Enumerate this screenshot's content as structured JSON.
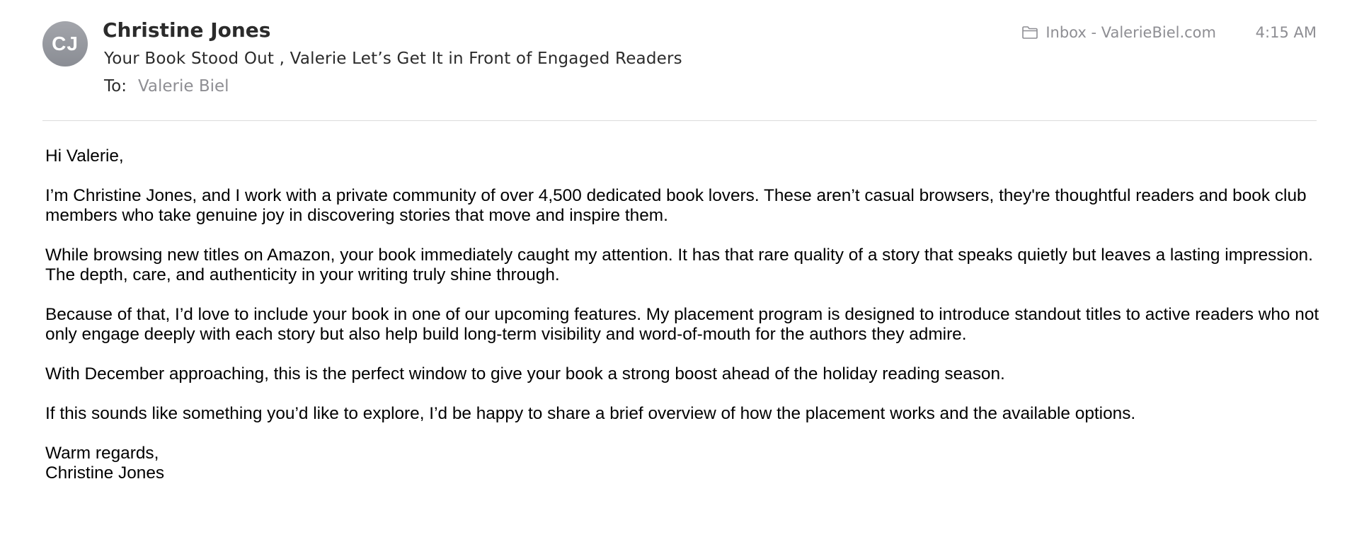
{
  "message": {
    "avatar_initials": "CJ",
    "sender": "Christine Jones",
    "subject": "Your Book Stood Out , Valerie Let’s Get It in Front of Engaged Readers",
    "to_label": "To:",
    "to_value": "Valerie Biel",
    "mailbox": "Inbox - ValerieBiel.com",
    "mailbox_icon": "folder-icon",
    "time": "4:15 AM"
  },
  "body": {
    "greeting": "Hi Valerie,",
    "paragraphs": [
      "I’m Christine Jones, and I work with a private community of over 4,500 dedicated book lovers. These aren’t casual browsers, they're thoughtful readers and book club members who take genuine joy in discovering stories that move and inspire them.",
      "While browsing new titles on Amazon, your book immediately caught my attention. It has that rare quality of a story that speaks quietly but leaves a lasting impression. The depth, care, and authenticity in your writing truly shine through.",
      "Because of that, I’d love to include your book in one of our upcoming features. My placement program is designed to introduce standout titles to active readers who not only engage deeply with each story but also help build long-term visibility and word-of-mouth for the authors they admire.",
      "With December approaching, this is the perfect window to give your book a strong boost ahead of the holiday reading season.",
      "If this sounds like something you’d like to explore, I’d be happy to share a brief overview of how the placement works and the available options."
    ],
    "closing": "Warm regards,",
    "signature": "Christine Jones"
  },
  "colors": {
    "secondary_text": "#8e8e93",
    "primary_text": "#2b2b2b",
    "divider": "#dcdcdc"
  }
}
